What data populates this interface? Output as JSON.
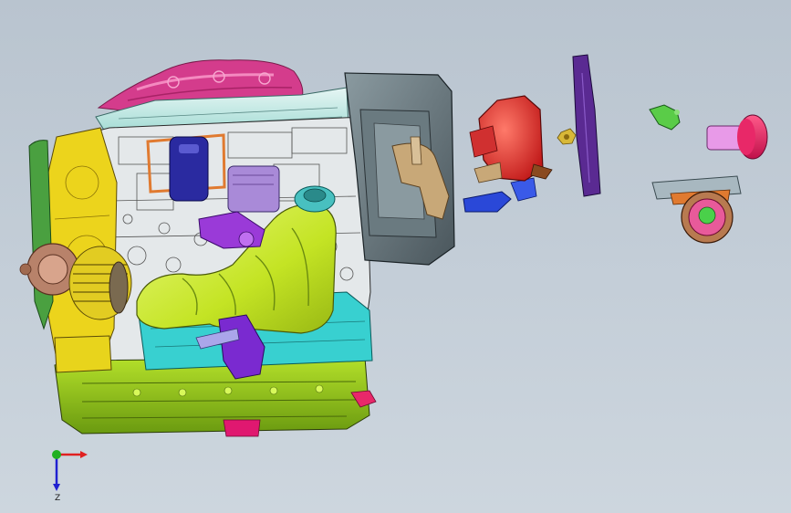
{
  "viewport": {
    "background": "#c4ced8"
  },
  "model": {
    "parts": [
      {
        "name": "oil-pan",
        "color": "#a8d81a"
      },
      {
        "name": "valve-cover",
        "color": "#d23a8a"
      },
      {
        "name": "transmission-housing",
        "color": "#5c6a70"
      },
      {
        "name": "intake-manifold",
        "color": "#c8ea1e"
      },
      {
        "name": "timing-cover",
        "color": "#e8d21a"
      },
      {
        "name": "engine-block",
        "color": "#e2e6e8"
      },
      {
        "name": "cylinder-head",
        "color": "#a8e8e0"
      },
      {
        "name": "alternator",
        "color": "#d2c01a"
      },
      {
        "name": "pulley",
        "color": "#b08068"
      },
      {
        "name": "oil-filter",
        "color": "#9a78d6"
      },
      {
        "name": "starter-motor",
        "color": "#e02828"
      },
      {
        "name": "bracket",
        "color": "#5a2a90"
      },
      {
        "name": "sensor",
        "color": "#4ac84a"
      },
      {
        "name": "solenoid",
        "color": "#e8286a"
      },
      {
        "name": "flywheel",
        "color": "#b87a50"
      }
    ]
  },
  "triad": {
    "x_color": "#e02020",
    "y_color": "#20b020",
    "z_color": "#2020d0",
    "z_label": "Z"
  }
}
